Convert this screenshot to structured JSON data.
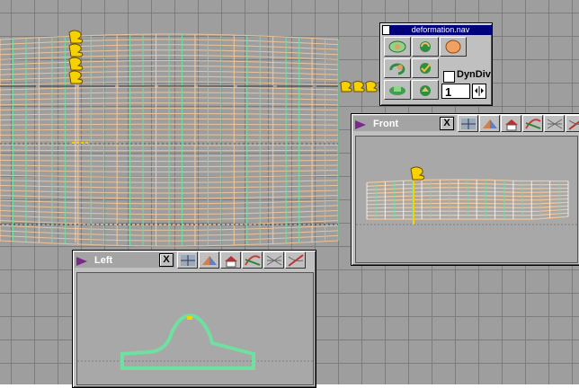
{
  "perspective": {
    "name": "perspective-viewport"
  },
  "nav_palette": {
    "title": "deformation.nav",
    "checkbox_label": "DynDiv",
    "checkbox_checked": false,
    "divisions_value": "1",
    "buttons": [
      "track-icon",
      "tumble-icon",
      "dolly-icon",
      "rotate-icon",
      "check-icon",
      "select-icon"
    ]
  },
  "front_view": {
    "title": "Front",
    "close_label": "X",
    "toolbar": [
      "grid-icon",
      "shade-icon",
      "house-icon",
      "curve-icon",
      "mesh-icon",
      "deform-icon"
    ]
  },
  "left_view": {
    "title": "Left",
    "close_label": "X",
    "toolbar": [
      "grid-icon",
      "shade-icon",
      "house-icon",
      "curve-icon",
      "mesh-icon",
      "deform-icon"
    ]
  },
  "colors": {
    "viewport_bg": "#9e9e9e",
    "grid_line": "#7d7d7d",
    "mesh_orange": "#f5c89a",
    "mesh_green": "#6fe0a0",
    "palette_title": "#00007b",
    "window_title": "#a4a4a4"
  }
}
